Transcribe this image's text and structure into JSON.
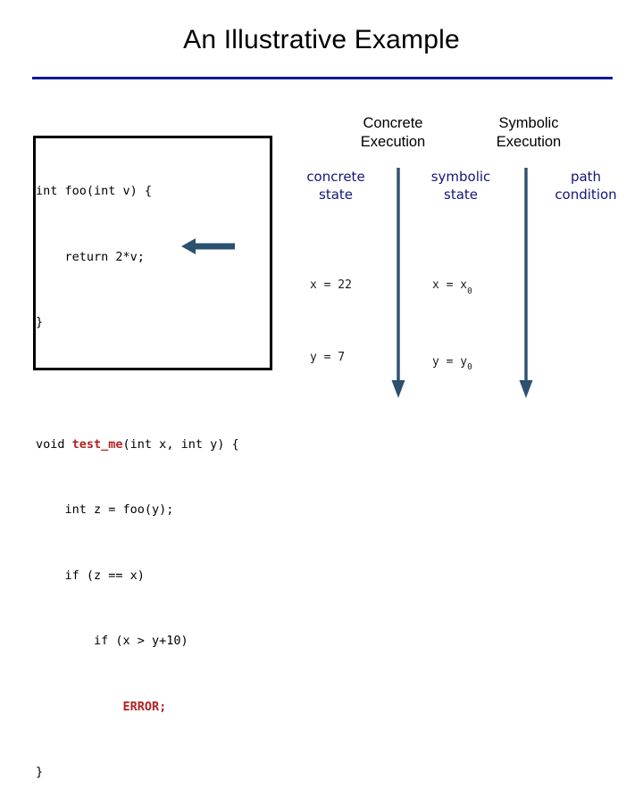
{
  "slide": {
    "title": "An Illustrative Example",
    "rule_color": "#0b1a9e"
  },
  "code_panel": {
    "name": "code-listing",
    "language": "c",
    "lines": [
      {
        "indent": 0,
        "text": "int foo(int v) {"
      },
      {
        "indent": 1,
        "text": "return 2*v;"
      },
      {
        "indent": 0,
        "text": "}"
      },
      {
        "indent": 0,
        "text": ""
      },
      {
        "indent": 0,
        "text": "void test_me(int x, int y) {"
      },
      {
        "indent": 1,
        "text": "int z = foo(y);"
      },
      {
        "indent": 1,
        "text": "if (z == x)"
      },
      {
        "indent": 2,
        "text": "if (x > y+10)"
      },
      {
        "indent": 3,
        "text": "ERROR;"
      },
      {
        "indent": 0,
        "text": "}"
      }
    ],
    "line_1": "int foo(int v) {",
    "line_2": "    return 2*v;",
    "line_3": "}",
    "line_5_a": "void ",
    "line_5_b": "test_me",
    "line_5_c": "(int x, int y) {",
    "line_6": "    int z = foo(y);",
    "line_7": "    if (z == x)",
    "line_8": "        if (x > y+10)",
    "line_9": "            ",
    "line_9_err": "ERROR;",
    "line_10": "}",
    "highlight_function": "test_me",
    "error_statement": "ERROR;",
    "function_color": "#b32121",
    "error_color": "#b32121",
    "border_color": "#000000"
  },
  "columns": {
    "concrete_execution_heading": "Concrete\nExecution",
    "symbolic_execution_heading": "Symbolic\nExecution",
    "concrete_execution_line1": "Concrete",
    "concrete_execution_line2": "Execution",
    "symbolic_execution_line1": "Symbolic",
    "symbolic_execution_line2": "Execution",
    "concrete_state_label_line1": "concrete",
    "concrete_state_label_line2": "state",
    "symbolic_state_label_line1": "symbolic",
    "symbolic_state_label_line2": "state",
    "path_condition_label_line1": "path",
    "path_condition_label_line2": "condition",
    "label_color": "#13147a"
  },
  "state_values": {
    "concrete": {
      "x": "x = 22",
      "y": "y = 7"
    },
    "symbolic": {
      "x_lhs": "x = x",
      "x_sub": "0",
      "y_lhs": "y = y",
      "y_sub": "0"
    }
  },
  "arrows": {
    "divider_color": "#2c5070",
    "pointer_color": "#2c5070",
    "pointer_target": "void test_me(int x, int y) {",
    "divider_1_name": "concrete-symbolic-divider-arrow",
    "divider_2_name": "symbolic-path-divider-arrow"
  }
}
